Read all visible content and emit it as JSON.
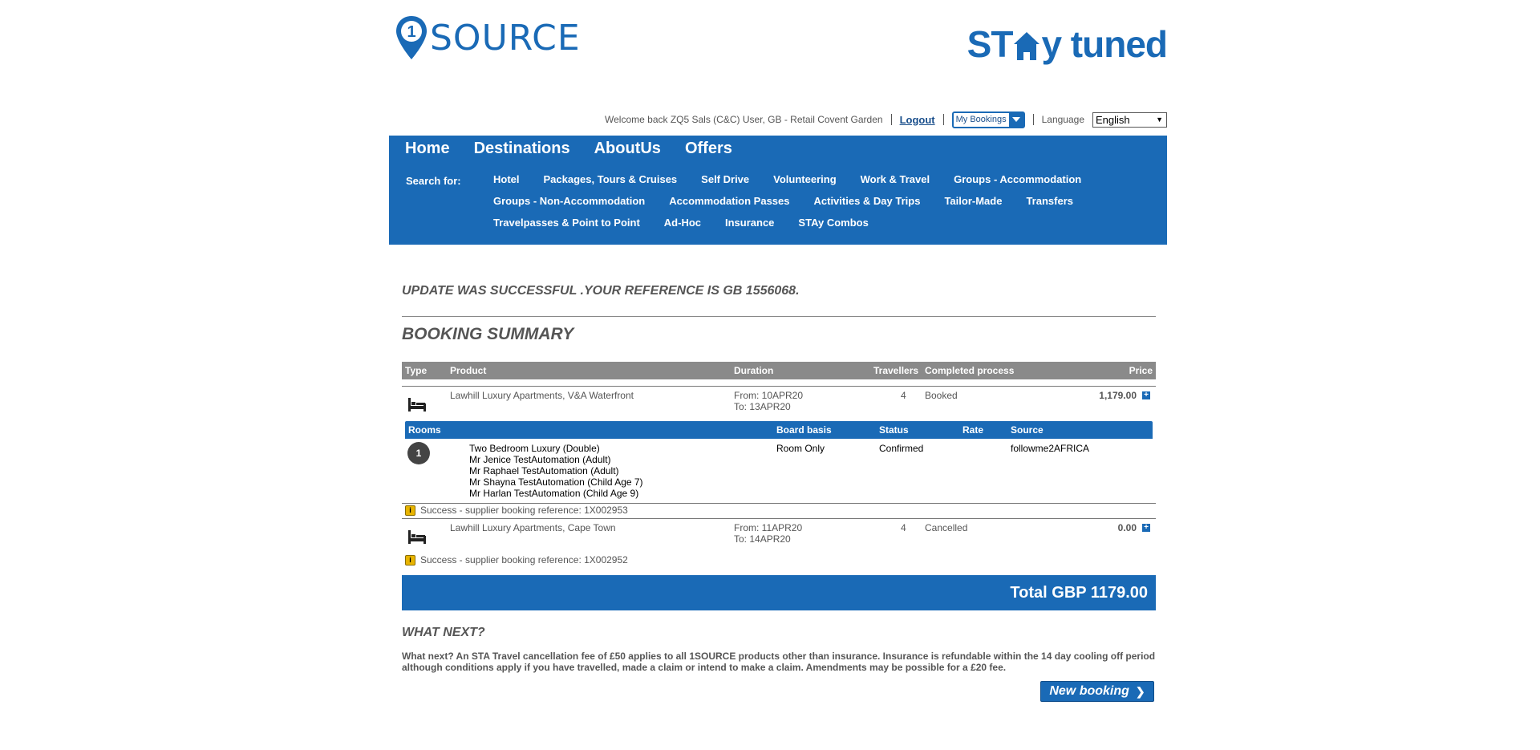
{
  "header": {
    "logo_left": "SOURCE",
    "logo_left_digit": "1",
    "logo_right_pre": "ST",
    "logo_right_mid": "y tuned",
    "welcome": "Welcome back ZQ5 Sals (C&C) User, GB - Retail Covent Garden",
    "logout": "Logout",
    "my_bookings": "My Bookings",
    "language_label": "Language",
    "language_value": "English"
  },
  "nav": {
    "main": [
      "Home",
      "Destinations",
      "AboutUs",
      "Offers"
    ],
    "search_for": "Search for:",
    "links": [
      [
        "Hotel",
        "Packages, Tours & Cruises",
        "Self Drive",
        "Volunteering",
        "Work & Travel",
        "Groups - Accommodation"
      ],
      [
        "Groups - Non-Accommodation",
        "Accommodation Passes",
        "Activities & Day Trips",
        "Tailor-Made",
        "Transfers"
      ],
      [
        "Travelpasses & Point to Point",
        "Ad-Hoc",
        "Insurance",
        "STAy Combos"
      ]
    ]
  },
  "message": "UPDATE WAS SUCCESSFUL .YOUR REFERENCE IS GB 1556068.",
  "summary_title": "BOOKING SUMMARY",
  "table": {
    "headers": {
      "type": "Type",
      "product": "Product",
      "duration": "Duration",
      "travellers": "Travellers",
      "completed": "Completed process",
      "price": "Price"
    },
    "rows": [
      {
        "product": "Lawhill Luxury Apartments, V&A Waterfront",
        "from": "From: 10APR20",
        "to": "To: 13APR20",
        "travellers": "4",
        "status": "Booked",
        "price": "1,179.00",
        "info": "Success - supplier booking reference: 1X002953"
      },
      {
        "product": "Lawhill Luxury Apartments, Cape Town",
        "from": "From: 11APR20",
        "to": "To: 14APR20",
        "travellers": "4",
        "status": "Cancelled",
        "price": "0.00",
        "info": "Success - supplier booking reference: 1X002952"
      }
    ],
    "rooms": {
      "headers": {
        "rooms": "Rooms",
        "board": "Board basis",
        "status": "Status",
        "rate": "Rate",
        "source": "Source"
      },
      "row": {
        "number": "1",
        "lines": [
          "Two Bedroom Luxury (Double)",
          "Mr Jenice TestAutomation (Adult)",
          "Mr Raphael TestAutomation (Adult)",
          "Mr Shayna TestAutomation (Child Age 7)",
          "Mr Harlan TestAutomation (Child Age 9)"
        ],
        "board": "Room Only",
        "status": "Confirmed",
        "rate": "",
        "source": "followme2AFRICA"
      }
    }
  },
  "total": "Total GBP  1179.00",
  "whatnext": {
    "title": "WHAT NEXT?",
    "text": "What next? An STA Travel cancellation fee of £50 applies to all 1SOURCE products other than insurance. Insurance is refundable within the 14 day cooling off period although conditions apply if you have travelled, made a claim or intend to make a claim. Amendments may be possible for a £20 fee.",
    "button": "New booking"
  },
  "colors": {
    "brand_blue": "#1a6ab6",
    "header_grey": "#8a8a8a",
    "info_yellow": "#e8b400"
  }
}
